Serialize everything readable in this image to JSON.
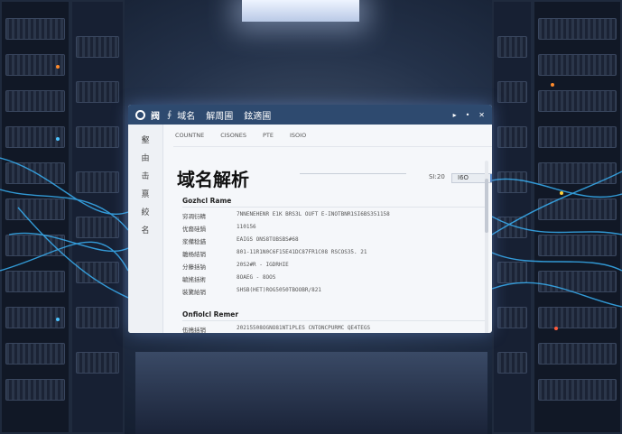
{
  "colors": {
    "titlebar": "#2e4a6f",
    "accent": "#5b88c7",
    "cable_glow": "#3ab8ff"
  },
  "window": {
    "app_name": "阀",
    "separator": "∮",
    "menus": [
      "域名",
      "解周圃",
      "鉉適圃"
    ],
    "controls": [
      "▸",
      "•",
      "✕"
    ]
  },
  "sidebar": {
    "items": [
      "壑",
      "由",
      "击",
      "禀",
      "絞",
      "名"
    ]
  },
  "tabs": [
    "COUNTNE",
    "CISONES",
    "PTE",
    "ISOIO"
  ],
  "header": {
    "title": "域名解析",
    "ctrl_label": "SI:20",
    "select_value": "I6O",
    "select_icon": "chevron-down-icon"
  },
  "section1": {
    "heading": "Gozhcl Rame",
    "rows": [
      {
        "key": "穷凋衍精",
        "value": "7NNENEHENR E1K BRS3L OUFT E-INOTBNR1SI6BS351158"
      },
      {
        "key": "优裔硅鍋",
        "value": "110156"
      },
      {
        "key": "浆備稔錨",
        "value": "EAIGS ONS8TOBSBS#68"
      },
      {
        "key": "雛杨結销",
        "value": "801-11R1N0C6F15E41DC87FR1C08 RSCOS35. 21"
      },
      {
        "key": "分藤括钠",
        "value": "20S2#R - IGDRHIE"
      },
      {
        "key": "毓搖括術",
        "value": "8OAEG - 8OOS"
      },
      {
        "key": "裝驚給销",
        "value": "SHSB(HET)ROG5050TBOOBR/821"
      }
    ]
  },
  "section2": {
    "heading": "Onfiolcl Remer",
    "rows": [
      {
        "key": "伍搗括销",
        "value": "20215508OGNO81NT1PLES CNTONCPURMC QE4TEGS"
      }
    ]
  }
}
